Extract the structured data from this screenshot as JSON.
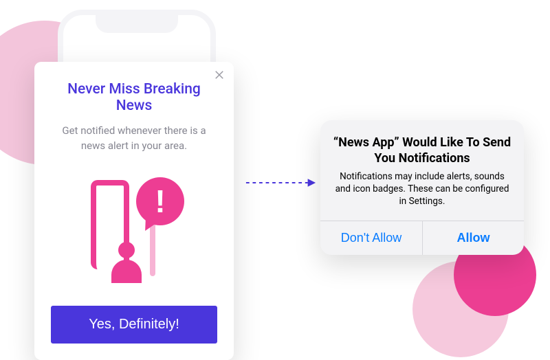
{
  "soft_prompt": {
    "title": "Never Miss Breaking News",
    "subtitle": "Get notified whenever there is a news alert in your area.",
    "cta_label": "Yes, Definitely!",
    "close_icon": "close-icon",
    "exclamation": "!"
  },
  "system_prompt": {
    "title": "“News App” Would Like To Send You Notifications",
    "message": "Notifications may include alerts, sounds and icon badges. These can be configured in Settings.",
    "deny_label": "Don't Allow",
    "allow_label": "Allow"
  },
  "colors": {
    "accent_purple": "#4a36dc",
    "accent_pink": "#ed3d93",
    "ios_blue": "#0a7cff"
  }
}
